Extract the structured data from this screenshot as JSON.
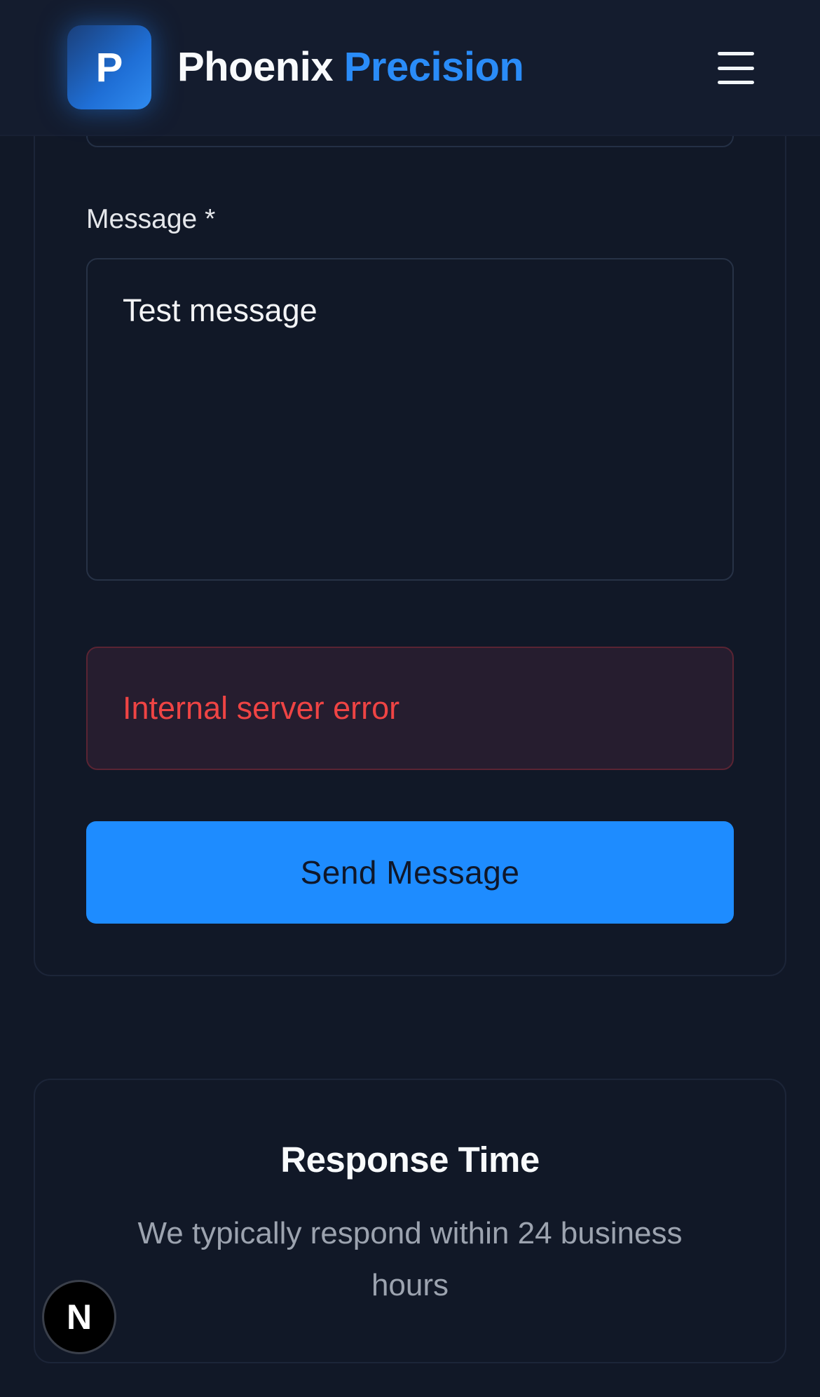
{
  "header": {
    "logo_letter": "P",
    "brand_word_1": "Phoenix",
    "brand_word_2": "Precision",
    "menu_icon": "hamburger-menu-icon"
  },
  "form": {
    "message_label": "Message *",
    "message_value": "Test message",
    "error_text": "Internal server error",
    "submit_label": "Send Message"
  },
  "response_card": {
    "title": "Response Time",
    "text": "We typically respond within 24 business hours"
  },
  "floating_badge": {
    "letter": "N"
  },
  "colors": {
    "background": "#111827",
    "accent": "#1e8cff",
    "brand_accent": "#2a8cf8",
    "error": "#ef4444",
    "muted_text": "#9ca3af"
  }
}
